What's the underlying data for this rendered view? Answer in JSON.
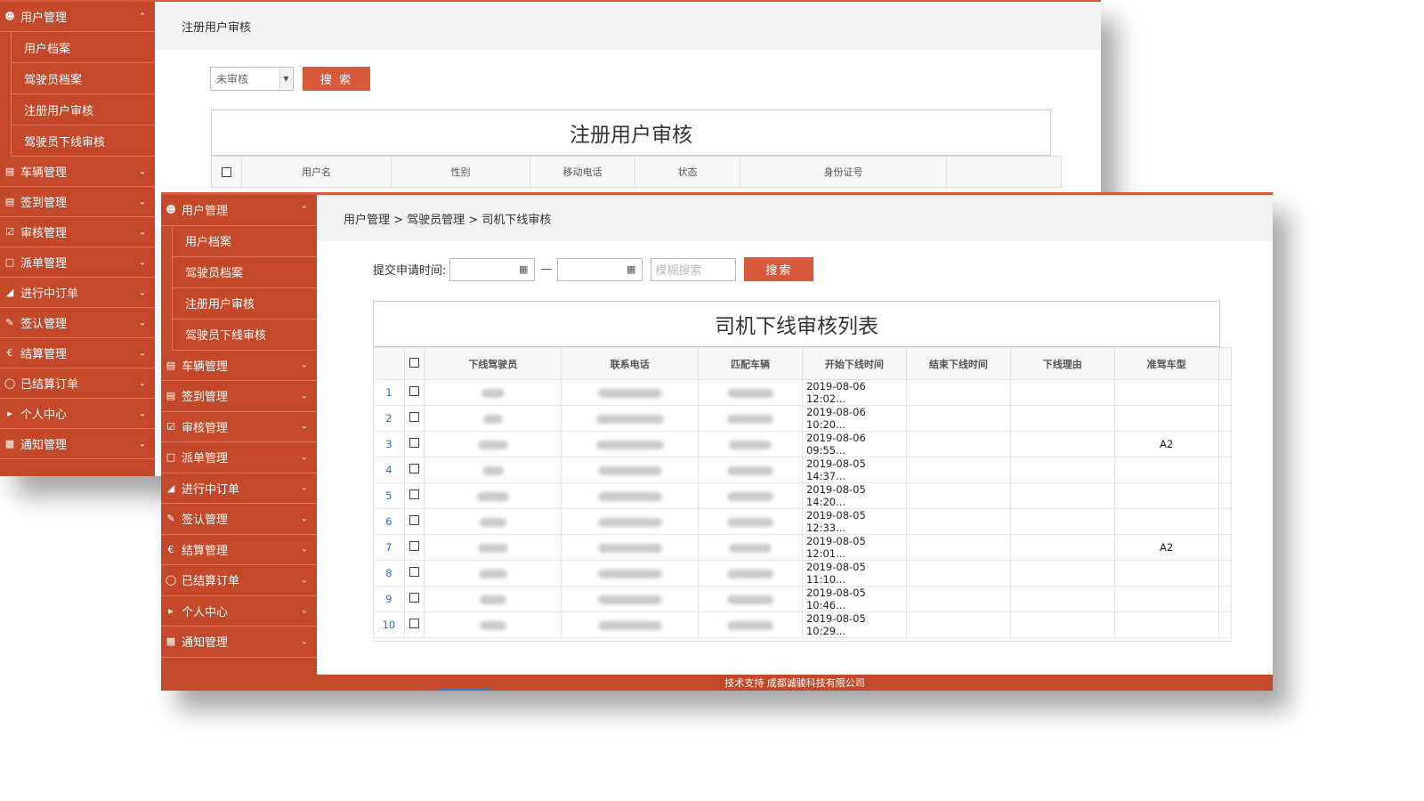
{
  "back_window": {
    "sidebar": {
      "top_menu": {
        "label": "用户管理",
        "icon": "user-icon"
      },
      "sub_items": [
        {
          "label": "用户档案"
        },
        {
          "label": "驾驶员档案"
        },
        {
          "label": "注册用户审核"
        },
        {
          "label": "驾驶员下线审核"
        }
      ],
      "menus": [
        {
          "label": "车辆管理",
          "icon": "car-icon"
        },
        {
          "label": "签到管理",
          "icon": "checkin-icon"
        },
        {
          "label": "审核管理",
          "icon": "audit-icon"
        },
        {
          "label": "派单管理",
          "icon": "dispatch-icon"
        },
        {
          "label": "进行中订单",
          "icon": "flag-icon"
        },
        {
          "label": "签认管理",
          "icon": "edit-icon"
        },
        {
          "label": "结算管理",
          "icon": "money-icon"
        },
        {
          "label": "已结算订单",
          "icon": "settled-icon"
        },
        {
          "label": "个人中心",
          "icon": "speaker-icon"
        },
        {
          "label": "通知管理",
          "icon": "chart-icon"
        }
      ]
    },
    "topbar_title": "注册用户审核",
    "filter": {
      "status_value": "未审核",
      "search_label": "搜 索"
    },
    "panel_title": "注册用户审核",
    "columns": [
      "用户名",
      "性别",
      "移动电话",
      "状态",
      "身份证号"
    ]
  },
  "front_window": {
    "sidebar": {
      "top_menu": {
        "label": "用户管理",
        "icon": "user-icon"
      },
      "sub_items": [
        {
          "label": "用户档案"
        },
        {
          "label": "驾驶员档案"
        },
        {
          "label": "注册用户审核"
        },
        {
          "label": "驾驶员下线审核"
        }
      ],
      "menus": [
        {
          "label": "车辆管理",
          "icon": "car-icon"
        },
        {
          "label": "签到管理",
          "icon": "checkin-icon"
        },
        {
          "label": "审核管理",
          "icon": "audit-icon"
        },
        {
          "label": "派单管理",
          "icon": "dispatch-icon"
        },
        {
          "label": "进行中订单",
          "icon": "flag-icon"
        },
        {
          "label": "签认管理",
          "icon": "edit-icon"
        },
        {
          "label": "结算管理",
          "icon": "money-icon"
        },
        {
          "label": "已结算订单",
          "icon": "settled-icon"
        },
        {
          "label": "个人中心",
          "icon": "speaker-icon"
        },
        {
          "label": "通知管理",
          "icon": "chart-icon"
        }
      ]
    },
    "breadcrumb": "用户管理 > 驾驶员管理 > 司机下线审核",
    "filter": {
      "date_label": "提交申请时间:",
      "dash": "—",
      "fuzzy_placeholder": "模糊搜索",
      "search_label": "搜索"
    },
    "panel_title": "司机下线审核列表",
    "columns": [
      "下线驾驶员",
      "联系电话",
      "匹配车辆",
      "开始下线时间",
      "结束下线时间",
      "下线理由",
      "准驾车型"
    ],
    "rows": [
      {
        "num": "1",
        "start_time": "2019-08-06 12:02...",
        "end_time": "",
        "reason": "",
        "license": ""
      },
      {
        "num": "2",
        "start_time": "2019-08-06 10:20...",
        "end_time": "",
        "reason": "",
        "license": ""
      },
      {
        "num": "3",
        "start_time": "2019-08-06 09:55...",
        "end_time": "",
        "reason": "",
        "license": "A2"
      },
      {
        "num": "4",
        "start_time": "2019-08-05 14:37...",
        "end_time": "",
        "reason": "",
        "license": ""
      },
      {
        "num": "5",
        "start_time": "2019-08-05 14:20...",
        "end_time": "",
        "reason": "",
        "license": ""
      },
      {
        "num": "6",
        "start_time": "2019-08-05 12:33...",
        "end_time": "",
        "reason": "",
        "license": ""
      },
      {
        "num": "7",
        "start_time": "2019-08-05 12:01...",
        "end_time": "",
        "reason": "",
        "license": "A2"
      },
      {
        "num": "8",
        "start_time": "2019-08-05 11:10...",
        "end_time": "",
        "reason": "",
        "license": ""
      },
      {
        "num": "9",
        "start_time": "2019-08-05 10:46...",
        "end_time": "",
        "reason": "",
        "license": ""
      },
      {
        "num": "10",
        "start_time": "2019-08-05 10:29...",
        "end_time": "",
        "reason": "",
        "license": ""
      }
    ],
    "footer": "技术支持 成都诚骏科技有限公司"
  },
  "colors": {
    "accent": "#c4492b",
    "button": "#d9593b",
    "link": "#2a6ebb"
  }
}
